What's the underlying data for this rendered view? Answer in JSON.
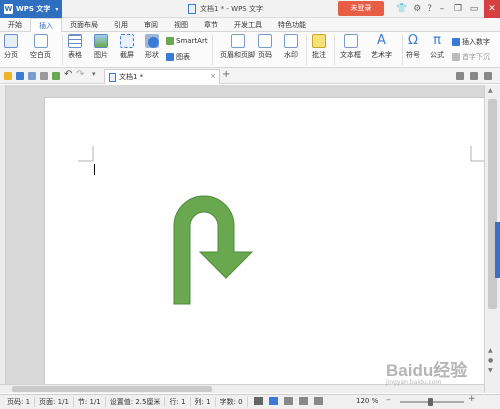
{
  "titlebar": {
    "app_name": "WPS 文字",
    "document_title": "文档1 * - WPS 文字",
    "login_label": "未登录"
  },
  "tabs": [
    "开始",
    "插入",
    "页面布局",
    "引用",
    "审阅",
    "视图",
    "章节",
    "开发工具",
    "特色功能"
  ],
  "active_tab": "插入",
  "ribbon": {
    "page_break": "分页",
    "blank_page": "空白页",
    "table": "表格",
    "picture": "图片",
    "screenshot": "截屏",
    "shape": "形状",
    "smartart": "SmartArt",
    "chart": "图表",
    "header_footer": "页眉和页脚",
    "page_number": "页码",
    "watermark": "水印",
    "comment": "批注",
    "textbox": "文本框",
    "wordart": "艺术字",
    "symbol": "符号",
    "formula": "公式",
    "insert_number": "插入数字",
    "first_drop": "首字下沉"
  },
  "doc_tab": {
    "label": "文档1 *"
  },
  "statusbar": {
    "page": "页码: 1",
    "pages": "页面: 1/1",
    "section": "节: 1/1",
    "setting_value": "设置值: 2.5厘米",
    "row": "行: 1",
    "column": "列: 1",
    "word_count": "字数: 0",
    "zoom": "120 %"
  },
  "shape": {
    "name": "u-turn-arrow",
    "fill": "#6aa84f",
    "stroke": "#4e8a3a"
  },
  "watermark": {
    "brand": "Baidu经验",
    "url": "jingyan.baidu.com"
  },
  "colors": {
    "accent": "#2f6fc0",
    "login": "#e85e44",
    "page_bg": "#ffffff",
    "workspace_bg": "#d8d8d8"
  }
}
